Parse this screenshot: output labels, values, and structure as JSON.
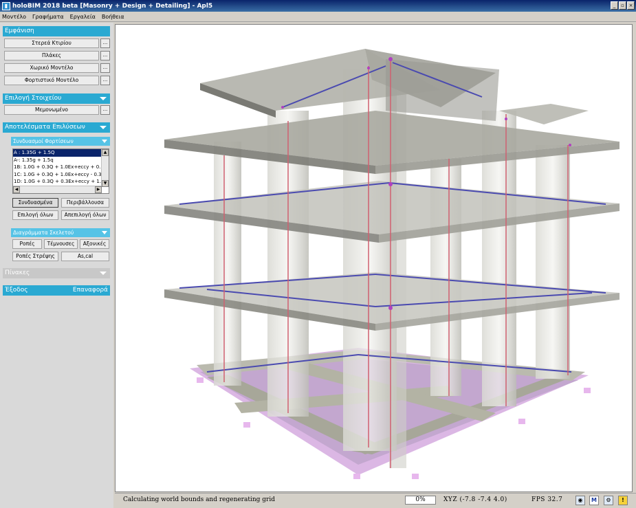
{
  "window": {
    "title": "holoBIM 2018 beta [Masonry + Design + Detailing] - Apl5",
    "min": "_",
    "max": "▫",
    "close": "×"
  },
  "menu": [
    "Μοντέλο",
    "Γραφήματα",
    "Εργαλεία",
    "Βοήθεια"
  ],
  "sidebar": {
    "emfanisi": {
      "title": "Εμφάνιση",
      "buttons": [
        "Στερεά Κτιρίου",
        "Πλάκες",
        "Χωρικό Μοντέλο",
        "Φορτιστικό Μοντέλο"
      ],
      "dots": "..."
    },
    "epilogi": {
      "title": "Επιλογή Στοιχείου",
      "button": "Μεμονωμένο"
    },
    "apotelesmata": {
      "title": "Αποτελέσματα Επιλύσεων",
      "combos_title": "Συνδυασμοί Φορτίσεων",
      "combos": [
        "A : 1.35G + 1.5Q",
        "A-: 1.35g + 1.5q",
        "1B: 1.0G + 0.3Q + 1.0Ex+eccy + 0.",
        "1C: 1.0G + 0.3Q + 1.0Ex+eccy - 0.3",
        "1D: 1.0G + 0.3Q + 0.3Ex+eccy + 1."
      ],
      "toggle_combined": "Συνδυασμένα",
      "toggle_envelope": "Περιβάλλουσα",
      "select_all": "Επιλογή όλων",
      "deselect_all": "Απεπιλογή όλων",
      "diagrams_title": "Διαγράμματα Σκελετού",
      "diagram_buttons": [
        "Ροπές",
        "Τέμνουσες",
        "Αξονικές",
        "Ροπές Στρέψης",
        "As,cal"
      ]
    },
    "pinakes": {
      "title": "Πίνακες"
    },
    "footer": {
      "exit": "Έξοδος",
      "reset": "Επαναφορά"
    }
  },
  "status": {
    "message": "Calculating world bounds and regenerating grid",
    "progress": "0%",
    "coords": "XYZ (-7.8 -7.4 4.0)",
    "fps": "FPS  32.7",
    "icon_m": "M",
    "icon_warn": "!"
  },
  "colors": {
    "accent": "#2aa9d2",
    "subaccent": "#56c3e6",
    "selection": "#0a246a",
    "foundation": "#c77ad6",
    "beam": "#4a4ab0",
    "rebar": "#d06070"
  }
}
